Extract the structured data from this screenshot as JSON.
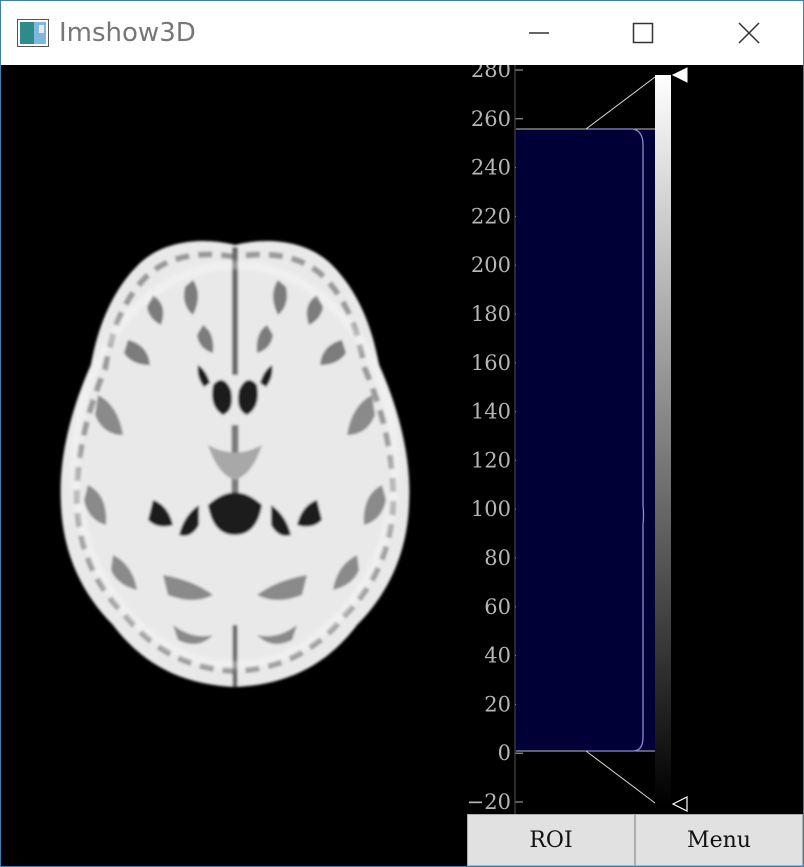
{
  "window": {
    "title": "Imshow3D",
    "controls": {
      "minimize_icon": "minimize-icon",
      "maximize_icon": "maximize-icon",
      "close_icon": "close-icon"
    }
  },
  "histogram_axis": {
    "ticks": [
      "280",
      "260",
      "240",
      "220",
      "200",
      "180",
      "160",
      "140",
      "120",
      "100",
      "80",
      "60",
      "40",
      "20",
      "0",
      "−20"
    ],
    "fill_color": "#000036",
    "outline_color": "#8a8ad8",
    "tick_color": "#b6b6b6"
  },
  "level_slider": {
    "upper_value": 255,
    "lower_value": 0,
    "colormap": "grayscale"
  },
  "buttons": {
    "roi_label": "ROI",
    "menu_label": "Menu"
  }
}
